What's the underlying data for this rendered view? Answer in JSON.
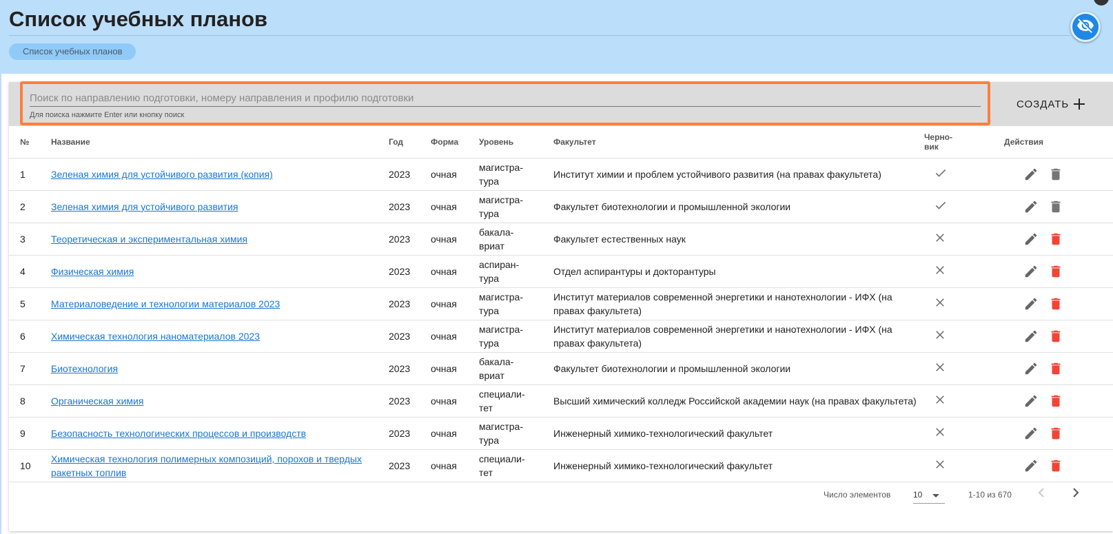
{
  "header": {
    "title": "Список учебных планов",
    "breadcrumb": "Список учебных планов"
  },
  "toolbar": {
    "search_placeholder": "Поиск по направлению подготовки, номеру направления и профилю подготовки",
    "search_value": "",
    "search_hint": "Для поиска нажмите Enter или кнопку поиск",
    "create_label": "СОЗДАТЬ",
    "highlight_color": "#ff7f3a"
  },
  "table": {
    "columns": {
      "num": "№",
      "name": "Название",
      "year": "Год",
      "form": "Форма",
      "level": "Уровень",
      "faculty": "Факультет",
      "draft_line1": "Черно-",
      "draft_line2": "вик",
      "actions": "Действия"
    },
    "rows": [
      {
        "num": "1",
        "name": "Зеленая химия для устойчивого развития (копия)",
        "year": "2023",
        "form": "очная",
        "level1": "магистра-",
        "level2": "тура",
        "faculty": "Институт химии и проблем устойчивого развития (на правах факультета)",
        "draft": true,
        "delete_enabled": false
      },
      {
        "num": "2",
        "name": "Зеленая химия для устойчивого развития",
        "year": "2023",
        "form": "очная",
        "level1": "магистра-",
        "level2": "тура",
        "faculty": "Факультет биотехнологии и промышленной экологии",
        "draft": true,
        "delete_enabled": false
      },
      {
        "num": "3",
        "name": "Теоретическая и экспериментальная химия",
        "year": "2023",
        "form": "очная",
        "level1": "бакала-",
        "level2": "вриат",
        "faculty": "Факультет естественных наук",
        "draft": false,
        "delete_enabled": true
      },
      {
        "num": "4",
        "name": "Физическая химия",
        "year": "2023",
        "form": "очная",
        "level1": "аспиран-",
        "level2": "тура",
        "faculty": "Отдел аспирантуры и докторантуры",
        "draft": false,
        "delete_enabled": true
      },
      {
        "num": "5",
        "name": "Материаловедение и технологии материалов 2023",
        "year": "2023",
        "form": "очная",
        "level1": "магистра-",
        "level2": "тура",
        "faculty": "Институт материалов современной энергетики и нанотехнологии - ИФХ (на правах факультета)",
        "draft": false,
        "delete_enabled": true
      },
      {
        "num": "6",
        "name": "Химическая технология наноматериалов 2023",
        "year": "2023",
        "form": "очная",
        "level1": "магистра-",
        "level2": "тура",
        "faculty": "Институт материалов современной энергетики и нанотехнологии - ИФХ (на правах факультета)",
        "draft": false,
        "delete_enabled": true
      },
      {
        "num": "7",
        "name": "Биотехнология",
        "year": "2023",
        "form": "очная",
        "level1": "бакала-",
        "level2": "вриат",
        "faculty": "Факультет биотехнологии и промышленной экологии",
        "draft": false,
        "delete_enabled": true
      },
      {
        "num": "8",
        "name": "Органическая химия",
        "year": "2023",
        "form": "очная",
        "level1": "специали-",
        "level2": "тет",
        "faculty": "Высший химический колледж Российской академии наук (на правах факультета)",
        "draft": false,
        "delete_enabled": true
      },
      {
        "num": "9",
        "name": "Безопасность технологических процессов и производств",
        "year": "2023",
        "form": "очная",
        "level1": "магистра-",
        "level2": "тура",
        "faculty": "Инженерный химико-технологический факультет",
        "draft": false,
        "delete_enabled": true
      },
      {
        "num": "10",
        "name": "Химическая технология полимерных композиций, порохов и твердых ракетных топлив",
        "year": "2023",
        "form": "очная",
        "level1": "специали-",
        "level2": "тет",
        "faculty": "Инженерный химико-технологический факультет",
        "draft": false,
        "delete_enabled": true
      }
    ]
  },
  "paginator": {
    "items_label": "Число элементов",
    "page_size": "10",
    "range": "1-10 из 670"
  },
  "colors": {
    "header_bg": "#bbdefb",
    "link": "#1976d2",
    "delete_active": "#f44336",
    "delete_disabled": "#757575",
    "accent": "#1e88e5"
  },
  "icons": {
    "visibility": "visibility-off-icon",
    "create": "plus-icon",
    "draft_true": "check-icon",
    "draft_false": "close-icon",
    "edit": "pencil-icon",
    "delete": "trash-icon"
  }
}
